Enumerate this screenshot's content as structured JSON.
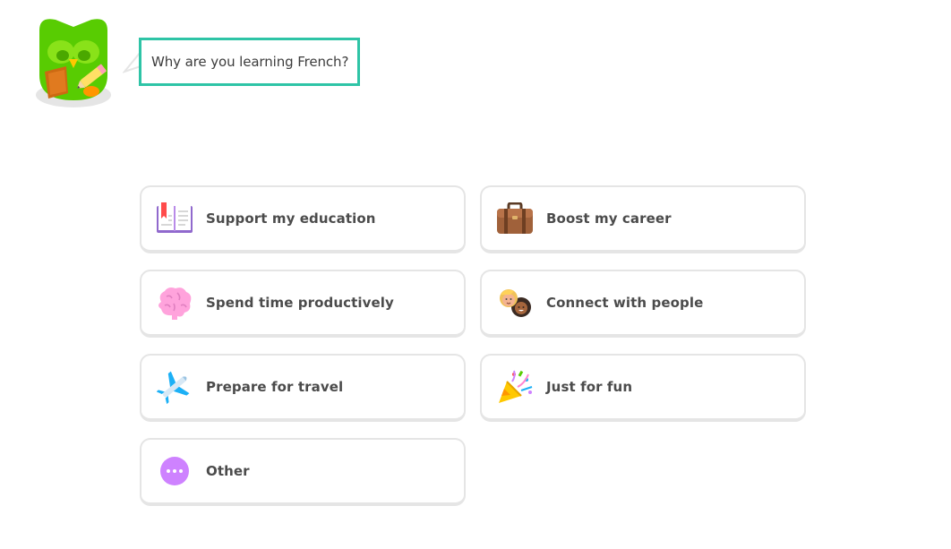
{
  "prompt": {
    "question": "Why are you learning French?"
  },
  "options": [
    {
      "label": "Support my education",
      "icon": "open-book-icon"
    },
    {
      "label": "Boost my career",
      "icon": "briefcase-icon"
    },
    {
      "label": "Spend time productively",
      "icon": "brain-icon"
    },
    {
      "label": "Connect with people",
      "icon": "people-icon"
    },
    {
      "label": "Prepare for travel",
      "icon": "airplane-icon"
    },
    {
      "label": "Just for fun",
      "icon": "party-popper-icon"
    },
    {
      "label": "Other",
      "icon": "more-dots-icon"
    }
  ],
  "colors": {
    "accent": "#2ec4a6",
    "border": "#e5e5e5",
    "text": "#4b4b4b",
    "mascot_green": "#58cc02"
  }
}
